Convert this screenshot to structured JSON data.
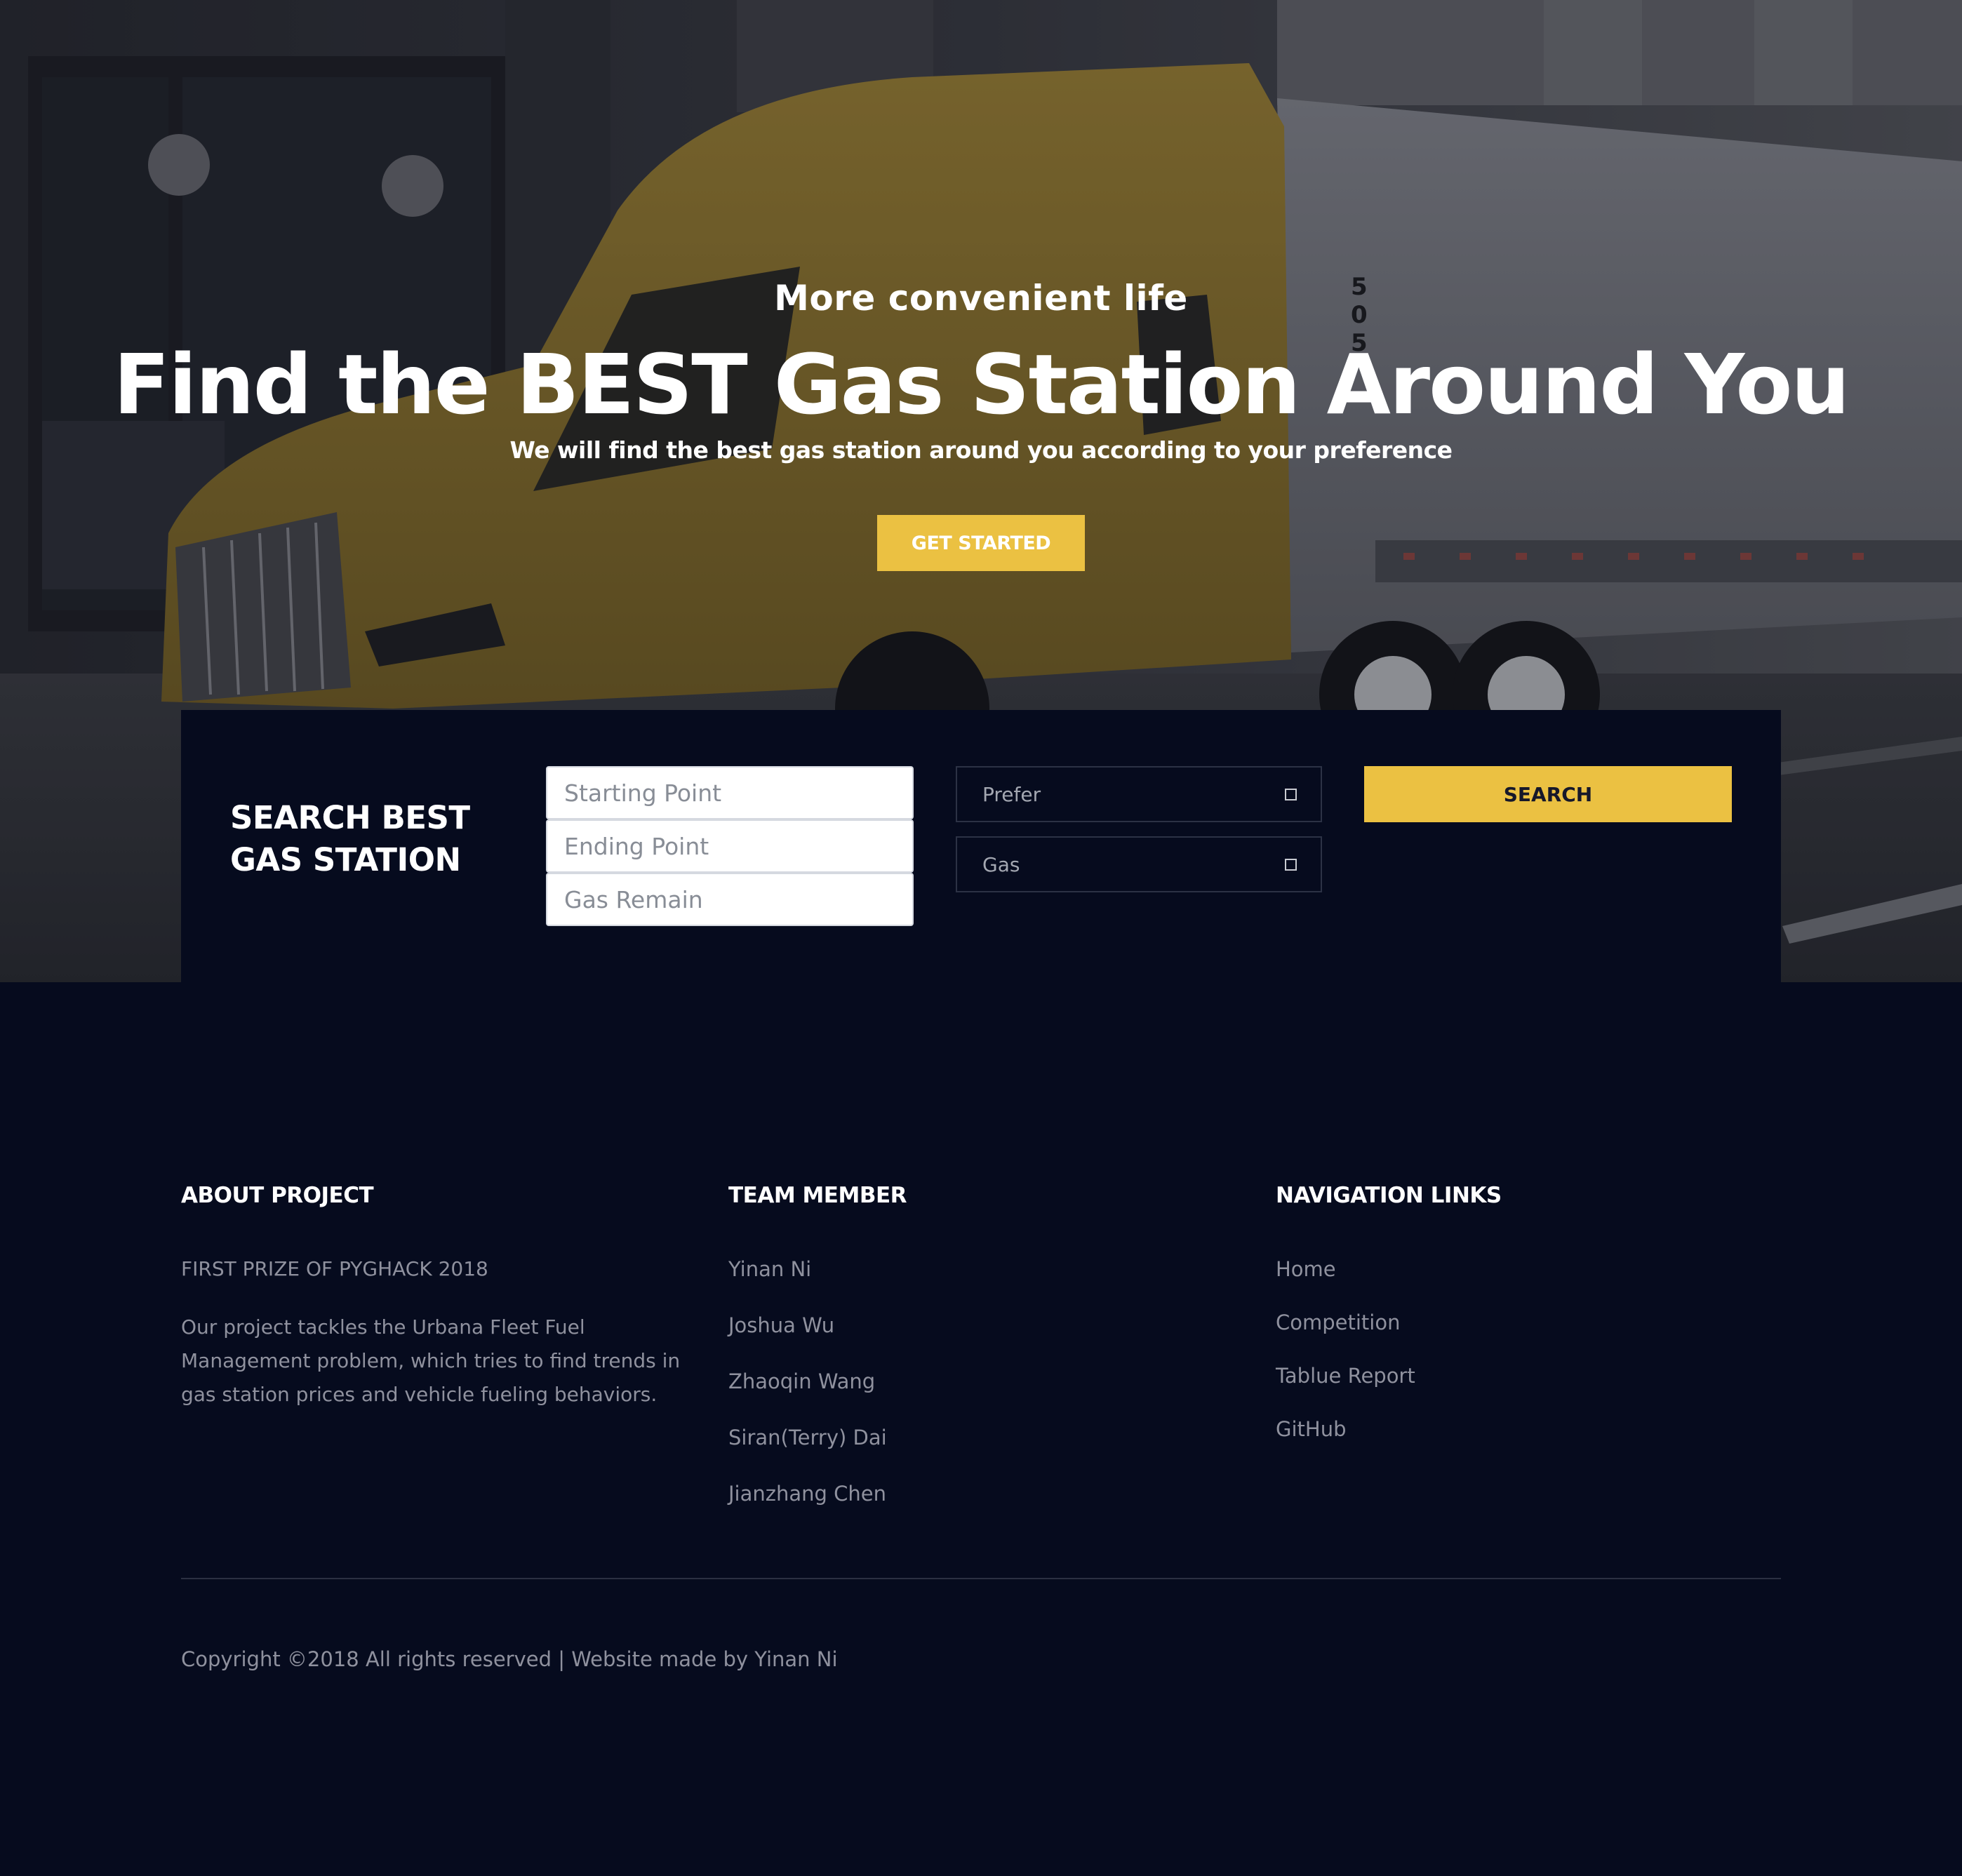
{
  "hero": {
    "eyebrow": "More convenient life",
    "title": "Find the BEST Gas Station Around You",
    "subtitle": "We will find the best gas station around you according to your preference",
    "cta_label": "GET STARTED",
    "accent_color": "#ebc142"
  },
  "search": {
    "heading": "SEARCH BEST GAS STATION",
    "starting_point_placeholder": "Starting Point",
    "ending_point_placeholder": "Ending Point",
    "gas_remain_placeholder": "Gas Remain",
    "prefer_select_value": "Prefer",
    "gas_select_value": "Gas",
    "search_label": "SEARCH"
  },
  "footer": {
    "about": {
      "title": "ABOUT PROJECT",
      "prize": "FIRST PRIZE OF PYGHACK 2018",
      "description": "Our project tackles the Urbana Fleet Fuel Management problem, which tries to find trends in gas station prices and vehicle fueling behaviors."
    },
    "team": {
      "title": "TEAM MEMBER",
      "members": [
        "Yinan Ni",
        "Joshua Wu",
        "Zhaoqin Wang",
        "Siran(Terry) Dai",
        "Jianzhang Chen"
      ]
    },
    "navigation": {
      "title": "NAVIGATION LINKS",
      "links": [
        "Home",
        "Competition",
        "Tablue Report",
        "GitHub"
      ]
    },
    "copyright": "Copyright ©2018 All rights reserved | Website made by Yinan Ni"
  },
  "colors": {
    "page_background": "#060b1e",
    "muted_text": "#8f919e"
  }
}
